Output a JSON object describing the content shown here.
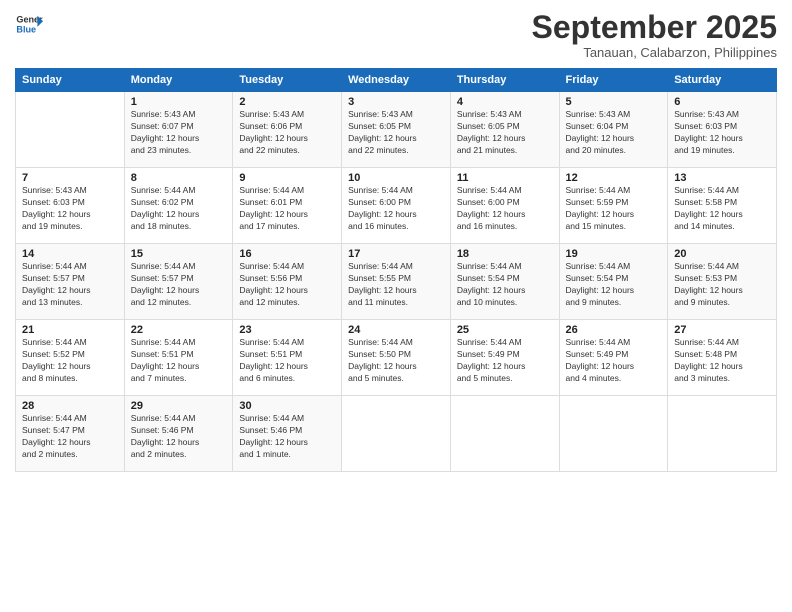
{
  "logo": {
    "line1": "General",
    "line2": "Blue"
  },
  "title": "September 2025",
  "subtitle": "Tanauan, Calabarzon, Philippines",
  "days_of_week": [
    "Sunday",
    "Monday",
    "Tuesday",
    "Wednesday",
    "Thursday",
    "Friday",
    "Saturday"
  ],
  "weeks": [
    [
      {
        "day": "",
        "info": ""
      },
      {
        "day": "1",
        "info": "Sunrise: 5:43 AM\nSunset: 6:07 PM\nDaylight: 12 hours\nand 23 minutes."
      },
      {
        "day": "2",
        "info": "Sunrise: 5:43 AM\nSunset: 6:06 PM\nDaylight: 12 hours\nand 22 minutes."
      },
      {
        "day": "3",
        "info": "Sunrise: 5:43 AM\nSunset: 6:05 PM\nDaylight: 12 hours\nand 22 minutes."
      },
      {
        "day": "4",
        "info": "Sunrise: 5:43 AM\nSunset: 6:05 PM\nDaylight: 12 hours\nand 21 minutes."
      },
      {
        "day": "5",
        "info": "Sunrise: 5:43 AM\nSunset: 6:04 PM\nDaylight: 12 hours\nand 20 minutes."
      },
      {
        "day": "6",
        "info": "Sunrise: 5:43 AM\nSunset: 6:03 PM\nDaylight: 12 hours\nand 19 minutes."
      }
    ],
    [
      {
        "day": "7",
        "info": "Sunrise: 5:43 AM\nSunset: 6:03 PM\nDaylight: 12 hours\nand 19 minutes."
      },
      {
        "day": "8",
        "info": "Sunrise: 5:44 AM\nSunset: 6:02 PM\nDaylight: 12 hours\nand 18 minutes."
      },
      {
        "day": "9",
        "info": "Sunrise: 5:44 AM\nSunset: 6:01 PM\nDaylight: 12 hours\nand 17 minutes."
      },
      {
        "day": "10",
        "info": "Sunrise: 5:44 AM\nSunset: 6:00 PM\nDaylight: 12 hours\nand 16 minutes."
      },
      {
        "day": "11",
        "info": "Sunrise: 5:44 AM\nSunset: 6:00 PM\nDaylight: 12 hours\nand 16 minutes."
      },
      {
        "day": "12",
        "info": "Sunrise: 5:44 AM\nSunset: 5:59 PM\nDaylight: 12 hours\nand 15 minutes."
      },
      {
        "day": "13",
        "info": "Sunrise: 5:44 AM\nSunset: 5:58 PM\nDaylight: 12 hours\nand 14 minutes."
      }
    ],
    [
      {
        "day": "14",
        "info": "Sunrise: 5:44 AM\nSunset: 5:57 PM\nDaylight: 12 hours\nand 13 minutes."
      },
      {
        "day": "15",
        "info": "Sunrise: 5:44 AM\nSunset: 5:57 PM\nDaylight: 12 hours\nand 12 minutes."
      },
      {
        "day": "16",
        "info": "Sunrise: 5:44 AM\nSunset: 5:56 PM\nDaylight: 12 hours\nand 12 minutes."
      },
      {
        "day": "17",
        "info": "Sunrise: 5:44 AM\nSunset: 5:55 PM\nDaylight: 12 hours\nand 11 minutes."
      },
      {
        "day": "18",
        "info": "Sunrise: 5:44 AM\nSunset: 5:54 PM\nDaylight: 12 hours\nand 10 minutes."
      },
      {
        "day": "19",
        "info": "Sunrise: 5:44 AM\nSunset: 5:54 PM\nDaylight: 12 hours\nand 9 minutes."
      },
      {
        "day": "20",
        "info": "Sunrise: 5:44 AM\nSunset: 5:53 PM\nDaylight: 12 hours\nand 9 minutes."
      }
    ],
    [
      {
        "day": "21",
        "info": "Sunrise: 5:44 AM\nSunset: 5:52 PM\nDaylight: 12 hours\nand 8 minutes."
      },
      {
        "day": "22",
        "info": "Sunrise: 5:44 AM\nSunset: 5:51 PM\nDaylight: 12 hours\nand 7 minutes."
      },
      {
        "day": "23",
        "info": "Sunrise: 5:44 AM\nSunset: 5:51 PM\nDaylight: 12 hours\nand 6 minutes."
      },
      {
        "day": "24",
        "info": "Sunrise: 5:44 AM\nSunset: 5:50 PM\nDaylight: 12 hours\nand 5 minutes."
      },
      {
        "day": "25",
        "info": "Sunrise: 5:44 AM\nSunset: 5:49 PM\nDaylight: 12 hours\nand 5 minutes."
      },
      {
        "day": "26",
        "info": "Sunrise: 5:44 AM\nSunset: 5:49 PM\nDaylight: 12 hours\nand 4 minutes."
      },
      {
        "day": "27",
        "info": "Sunrise: 5:44 AM\nSunset: 5:48 PM\nDaylight: 12 hours\nand 3 minutes."
      }
    ],
    [
      {
        "day": "28",
        "info": "Sunrise: 5:44 AM\nSunset: 5:47 PM\nDaylight: 12 hours\nand 2 minutes."
      },
      {
        "day": "29",
        "info": "Sunrise: 5:44 AM\nSunset: 5:46 PM\nDaylight: 12 hours\nand 2 minutes."
      },
      {
        "day": "30",
        "info": "Sunrise: 5:44 AM\nSunset: 5:46 PM\nDaylight: 12 hours\nand 1 minute."
      },
      {
        "day": "",
        "info": ""
      },
      {
        "day": "",
        "info": ""
      },
      {
        "day": "",
        "info": ""
      },
      {
        "day": "",
        "info": ""
      }
    ]
  ]
}
